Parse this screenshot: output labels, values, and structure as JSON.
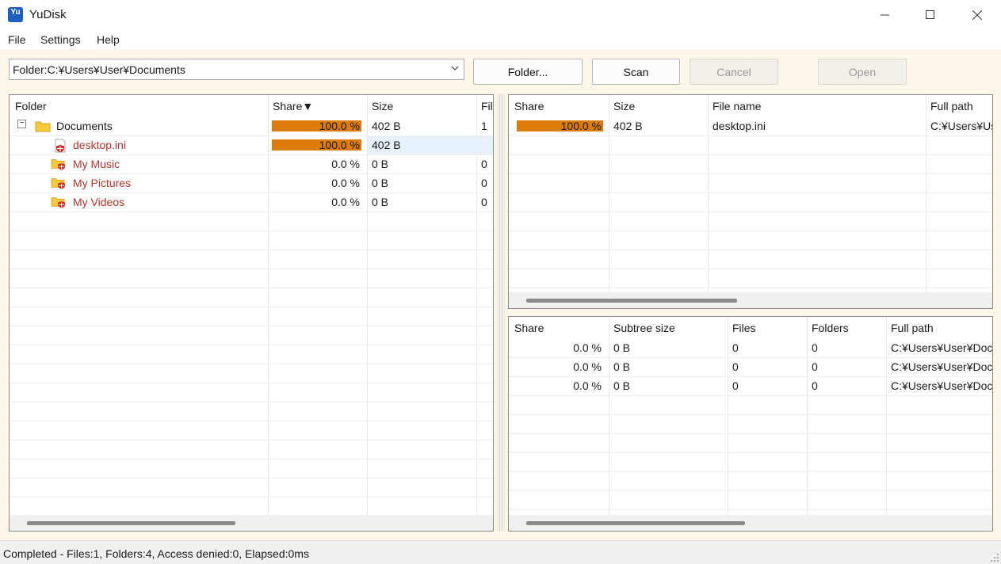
{
  "window": {
    "title": "YuDisk",
    "icon_text": "Yu"
  },
  "menu": {
    "file": "File",
    "settings": "Settings",
    "help": "Help"
  },
  "toolbar": {
    "path_value": "Folder:C:¥Users¥User¥Documents",
    "folder_button": "Folder...",
    "scan_button": "Scan",
    "cancel_button": "Cancel",
    "open_button": "Open"
  },
  "tree": {
    "columns": [
      "Folder",
      "Share▼",
      "Size",
      "Fil"
    ],
    "rows": [
      {
        "name": "Documents",
        "share": "100.0 %",
        "share_fraction": 1.0,
        "size": "402 B",
        "files": "1"
      },
      {
        "name": "desktop.ini",
        "share": "100.0 %",
        "share_fraction": 1.0,
        "size": "402 B",
        "files": ""
      },
      {
        "name": "My Music",
        "share": "0.0 %",
        "share_fraction": 0.0,
        "size": "0 B",
        "files": "0"
      },
      {
        "name": "My Pictures",
        "share": "0.0 %",
        "share_fraction": 0.0,
        "size": "0 B",
        "files": "0"
      },
      {
        "name": "My Videos",
        "share": "0.0 %",
        "share_fraction": 0.0,
        "size": "0 B",
        "files": "0"
      }
    ]
  },
  "files_table": {
    "columns": [
      "Share",
      "Size",
      "File name",
      "Full path"
    ],
    "rows": [
      {
        "share": "100.0 %",
        "share_fraction": 1.0,
        "size": "402 B",
        "name": "desktop.ini",
        "path": "C:¥Users¥Us"
      }
    ]
  },
  "folders_table": {
    "columns": [
      "Share",
      "Subtree size",
      "Files",
      "Folders",
      "Full path"
    ],
    "rows": [
      {
        "share": "0.0 %",
        "size": "0 B",
        "files": "0",
        "folders": "0",
        "path": "C:¥Users¥User¥Doc"
      },
      {
        "share": "0.0 %",
        "size": "0 B",
        "files": "0",
        "folders": "0",
        "path": "C:¥Users¥User¥Doc"
      },
      {
        "share": "0.0 %",
        "size": "0 B",
        "files": "0",
        "folders": "0",
        "path": "C:¥Users¥User¥Doc"
      }
    ]
  },
  "status": {
    "text": "Completed - Files:1, Folders:4, Access denied:0, Elapsed:0ms"
  },
  "colors": {
    "share_bar": "#dc7b08",
    "denied_text": "#b4352d",
    "toolbar_bg": "#fdf7e9"
  }
}
